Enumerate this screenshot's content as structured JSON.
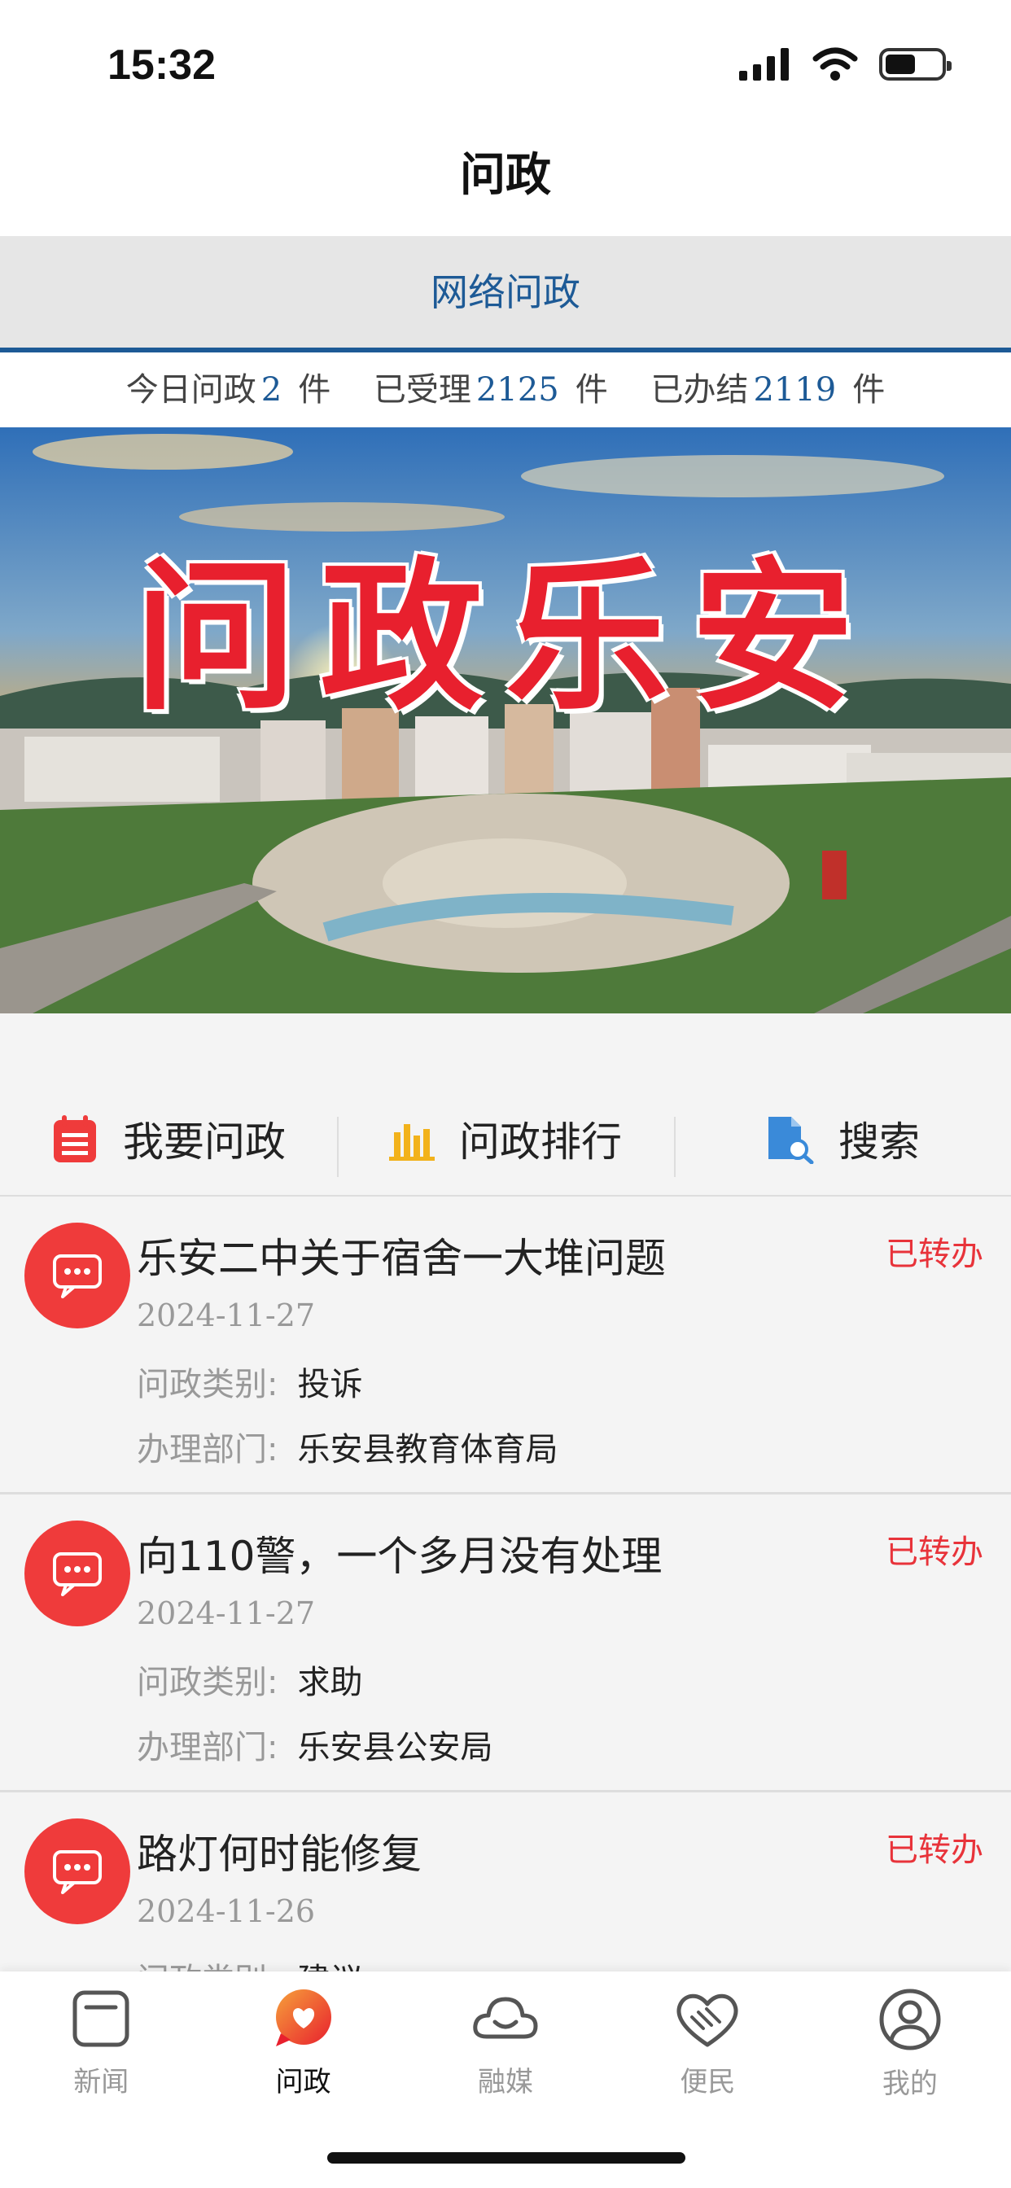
{
  "status": {
    "time": "15:32"
  },
  "nav": {
    "title": "问政"
  },
  "subtab": {
    "label": "网络问政"
  },
  "stats": {
    "today_label": "今日问政",
    "today_count": "2",
    "accepted_label": "已受理",
    "accepted_count": "2125",
    "done_label": "已办结",
    "done_count": "2119",
    "unit": "件"
  },
  "banner": {
    "title": "问政乐安"
  },
  "actions": [
    {
      "label": "我要问政",
      "icon": "calendar-form-icon"
    },
    {
      "label": "问政排行",
      "icon": "bar-chart-icon"
    },
    {
      "label": "搜索",
      "icon": "file-search-icon"
    }
  ],
  "list": {
    "category_label": "问政类别:",
    "dept_label": "办理部门:",
    "items": [
      {
        "title": "乐安二中关于宿舍一大堆问题",
        "status": "已转办",
        "date": "2024-11-27",
        "category": "投诉",
        "dept": "乐安县教育体育局"
      },
      {
        "title": "向110警，一个多月没有处理",
        "status": "已转办",
        "date": "2024-11-27",
        "category": "求助",
        "dept": "乐安县公安局"
      },
      {
        "title": "路灯何时能修复",
        "status": "已转办",
        "date": "2024-11-26",
        "category": "建议",
        "dept": ""
      }
    ]
  },
  "tabs": [
    {
      "label": "新闻",
      "icon": "news-icon"
    },
    {
      "label": "问政",
      "icon": "heart-chat-icon"
    },
    {
      "label": "融媒",
      "icon": "cloud-smile-icon"
    },
    {
      "label": "便民",
      "icon": "handshake-heart-icon"
    },
    {
      "label": "我的",
      "icon": "user-icon"
    }
  ],
  "colors": {
    "accent": "#1d5a96",
    "red": "#ef3b3b",
    "status": "#e8333a"
  }
}
